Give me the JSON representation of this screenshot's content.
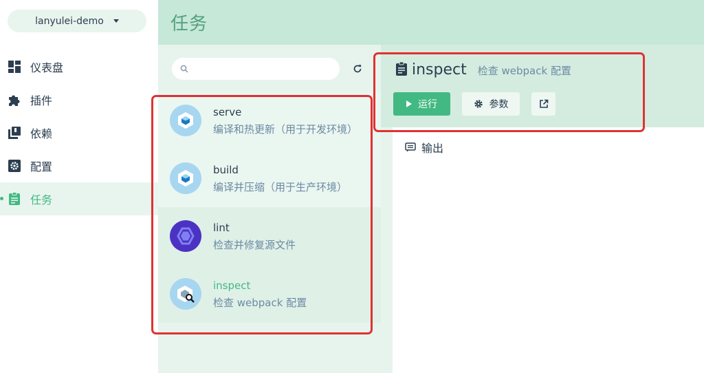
{
  "project": {
    "name": "lanyulei-demo"
  },
  "sidebar": {
    "items": [
      {
        "label": "仪表盘",
        "icon": "dashboard-icon",
        "active": false
      },
      {
        "label": "插件",
        "icon": "puzzle-icon",
        "active": false
      },
      {
        "label": "依赖",
        "icon": "library-icon",
        "active": false
      },
      {
        "label": "配置",
        "icon": "settings-icon",
        "active": false
      },
      {
        "label": "任务",
        "icon": "assignment-icon",
        "active": true
      }
    ]
  },
  "header": {
    "title": "任务"
  },
  "search": {
    "placeholder": "",
    "value": ""
  },
  "tasks": [
    {
      "name": "serve",
      "description": "编译和热更新（用于开发环境）",
      "icon": "webpack-icon"
    },
    {
      "name": "build",
      "description": "编译并压缩（用于生产环境）",
      "icon": "webpack-icon"
    },
    {
      "name": "lint",
      "description": "检查并修复源文件",
      "icon": "eslint-icon"
    },
    {
      "name": "inspect",
      "description": "检查 webpack 配置",
      "icon": "webpack-inspect-icon",
      "selected": true
    }
  ],
  "detail": {
    "name": "inspect",
    "description": "检查 webpack 配置",
    "run_label": "运行",
    "params_label": "参数",
    "output_label": "输出"
  },
  "colors": {
    "accent": "#42b983",
    "header_bg": "#c5e8d8",
    "annotation": "#e03131"
  }
}
